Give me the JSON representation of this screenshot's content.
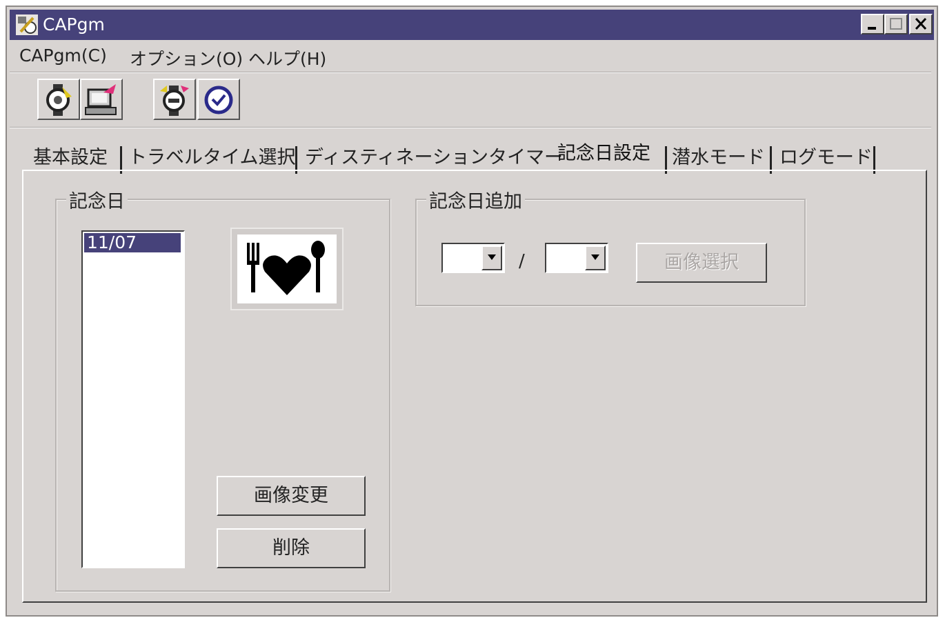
{
  "window": {
    "title": "CAPgm"
  },
  "menu": [
    {
      "label": "CAPgm(C)"
    },
    {
      "label": "オプション(O)"
    },
    {
      "label": "ヘルプ(H)"
    }
  ],
  "toolbar": [
    {
      "icon": "watch-sync-icon"
    },
    {
      "icon": "pc-transfer-icon"
    },
    {
      "icon": "watch-settings-icon"
    },
    {
      "icon": "clock-icon"
    }
  ],
  "tabs": [
    {
      "label": "基本設定"
    },
    {
      "label": "トラベルタイム選択"
    },
    {
      "label": "ディスティネーションタイマー"
    },
    {
      "label": "記念日設定",
      "active": true
    },
    {
      "label": "潜水モード"
    },
    {
      "label": "ログモード"
    }
  ],
  "anniversary_group": {
    "label": "記念日",
    "list": [
      "11/07"
    ],
    "selected": "11/07",
    "preview_icon": "fork-heart-spoon-icon",
    "change_image_label": "画像変更",
    "delete_label": "削除"
  },
  "add_group": {
    "label": "記念日追加",
    "month_value": "",
    "day_value": "",
    "separator": "/",
    "select_image_label": "画像選択"
  },
  "colors": {
    "titlebar": "#46427a",
    "selection": "#46427a",
    "face": "#d8d4d2"
  }
}
